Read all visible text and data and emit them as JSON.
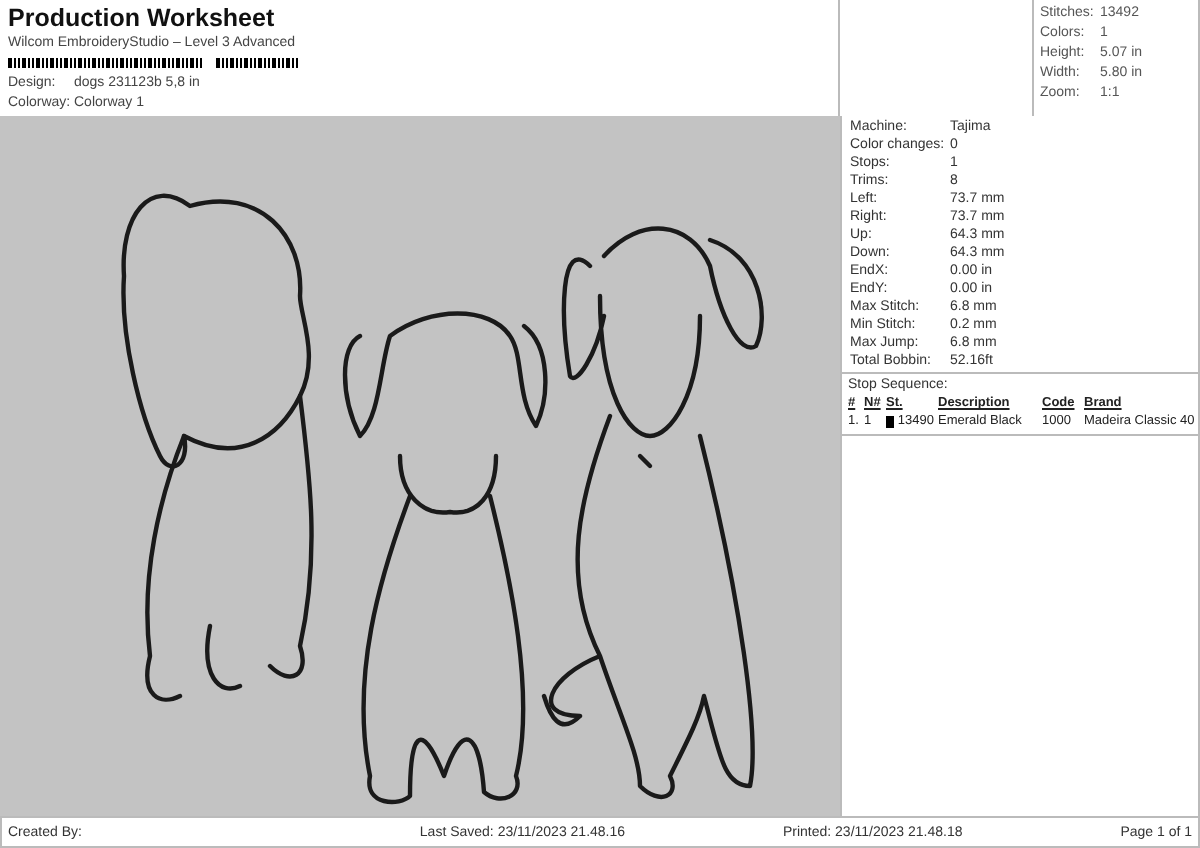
{
  "header": {
    "title": "Production Worksheet",
    "subtitle": "Wilcom EmbroideryStudio – Level 3 Advanced",
    "fields": [
      {
        "label": "Design:",
        "value": "dogs 231123b 5,8 in"
      },
      {
        "label": "Colorway:",
        "value": "Colorway 1"
      }
    ]
  },
  "summary": [
    {
      "label": "Stitches:",
      "value": "13492"
    },
    {
      "label": "Colors:",
      "value": "1"
    },
    {
      "label": "Height:",
      "value": "5.07 in"
    },
    {
      "label": "Width:",
      "value": "5.80 in"
    },
    {
      "label": "Zoom:",
      "value": "1:1"
    }
  ],
  "details": [
    {
      "label": "Machine:",
      "value": "Tajima"
    },
    {
      "label": "Color changes:",
      "value": "0"
    },
    {
      "label": "Stops:",
      "value": "1"
    },
    {
      "label": "Trims:",
      "value": "8"
    },
    {
      "label": "Left:",
      "value": "73.7 mm"
    },
    {
      "label": "Right:",
      "value": "73.7 mm"
    },
    {
      "label": "Up:",
      "value": "64.3 mm"
    },
    {
      "label": "Down:",
      "value": "64.3 mm"
    },
    {
      "label": "EndX:",
      "value": "0.00 in"
    },
    {
      "label": "EndY:",
      "value": "0.00 in"
    },
    {
      "label": "Max Stitch:",
      "value": "6.8 mm"
    },
    {
      "label": "Min Stitch:",
      "value": "0.2 mm"
    },
    {
      "label": "Max Jump:",
      "value": "6.8 mm"
    },
    {
      "label": "Total Bobbin:",
      "value": "52.16ft"
    }
  ],
  "stop_sequence": {
    "title": "Stop Sequence:",
    "columns": [
      "#",
      "N#",
      "St.",
      "Description",
      "Code",
      "Brand"
    ],
    "rows": [
      {
        "index": "1.",
        "needle": "1",
        "color": "#000000",
        "stitches": "13490",
        "description": "Emerald Black",
        "code": "1000",
        "brand": "Madeira Classic 40"
      }
    ]
  },
  "footer": {
    "created_by": "Created By:",
    "last_saved": "Last Saved: 23/11/2023 21.48.16",
    "printed": "Printed: 23/11/2023 21.48.18",
    "page": "Page 1 of 1"
  }
}
